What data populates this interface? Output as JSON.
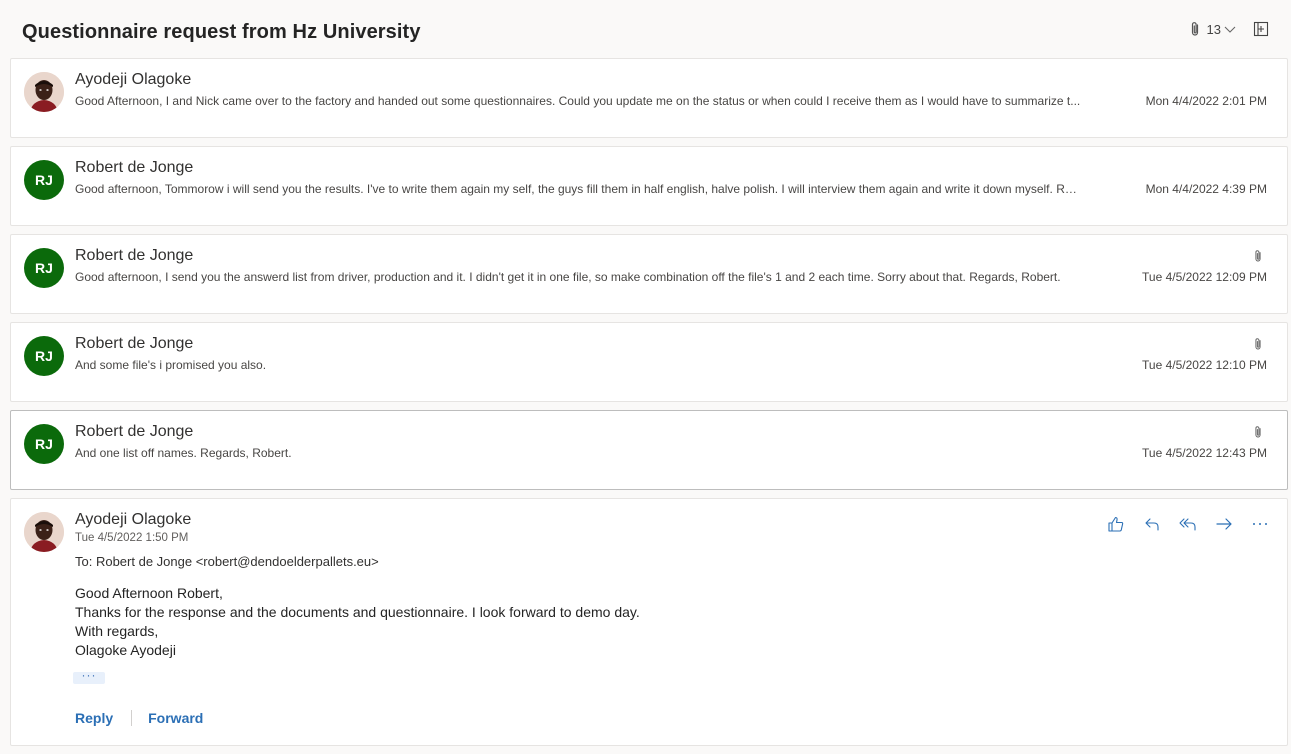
{
  "conversation": {
    "title": "Questionnaire request from Hz University",
    "attachment_count": "13",
    "icons": {
      "attachment": "paperclip-icon",
      "count_dropdown": "chevron-down-icon",
      "expand": "expand-icon"
    }
  },
  "messages": [
    {
      "sender": "Ayodeji Olagoke",
      "avatar_type": "photo",
      "preview": "Good Afternoon, I and Nick came over to the factory and handed out some questionnaires. Could you update me on the status or when could I receive them as I would have to summarize t...",
      "date": "Mon 4/4/2022 2:01 PM",
      "has_attachment": false
    },
    {
      "sender": "Robert de Jonge",
      "initials": "RJ",
      "preview": "Good afternoon, Tommorow i will send you the results. I've to write them again my self, the guys fill them in half english, halve polish. I will interview them again and write it down myself. Ro...",
      "date": "Mon 4/4/2022 4:39 PM",
      "has_attachment": false
    },
    {
      "sender": "Robert de Jonge",
      "initials": "RJ",
      "preview": "Good afternoon, I send you the answerd list from driver, production and it. I didn't get it in one file, so make combination off the file's 1 and 2 each time. Sorry about that. Regards, Robert.",
      "date": "Tue 4/5/2022 12:09 PM",
      "has_attachment": true
    },
    {
      "sender": "Robert de Jonge",
      "initials": "RJ",
      "preview": "And some file's i promised you also.",
      "date": "Tue 4/5/2022 12:10 PM",
      "has_attachment": true
    },
    {
      "sender": "Robert de Jonge",
      "initials": "RJ",
      "preview": "And one list off names. Regards, Robert.",
      "date": "Tue 4/5/2022 12:43 PM",
      "has_attachment": true,
      "selected": true
    }
  ],
  "open_message": {
    "sender": "Ayodeji Olagoke",
    "date": "Tue 4/5/2022 1:50 PM",
    "to": "To: Robert de Jonge <robert@dendoelderpallets.eu>",
    "body": [
      "Good Afternoon Robert,",
      "Thanks for the response and the documents and questionnaire. I look forward to demo day.",
      "With regards,",
      "Olagoke Ayodeji"
    ],
    "show_more": "···",
    "actions": [
      "like-icon",
      "reply-icon",
      "reply-all-icon",
      "forward-icon",
      "more-icon"
    ],
    "reply_label": "Reply",
    "forward_label": "Forward"
  },
  "colors": {
    "accent": "#2b6fb5",
    "avatar_green": "#0b6a0b"
  }
}
